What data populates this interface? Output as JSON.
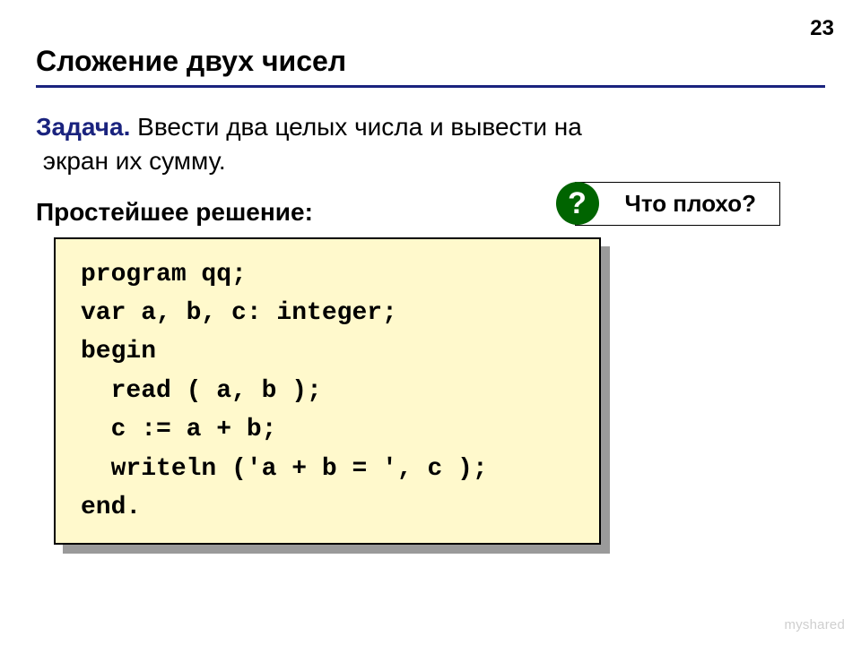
{
  "page_number": "23",
  "title": "Сложение двух чисел",
  "task": {
    "label": "Задача.",
    "text_line1": " Ввести два целых числа и вывести на",
    "text_line2": "экран их сумму."
  },
  "solution_label": "Простейшее решение:",
  "callout": {
    "badge": "?",
    "text": "Что плохо?"
  },
  "code": "program qq;\nvar a, b, c: integer;\nbegin\n  read ( a, b );\n  c := a + b;\n  writeln ('a + b = ', c );\nend.",
  "watermark": "myshared"
}
